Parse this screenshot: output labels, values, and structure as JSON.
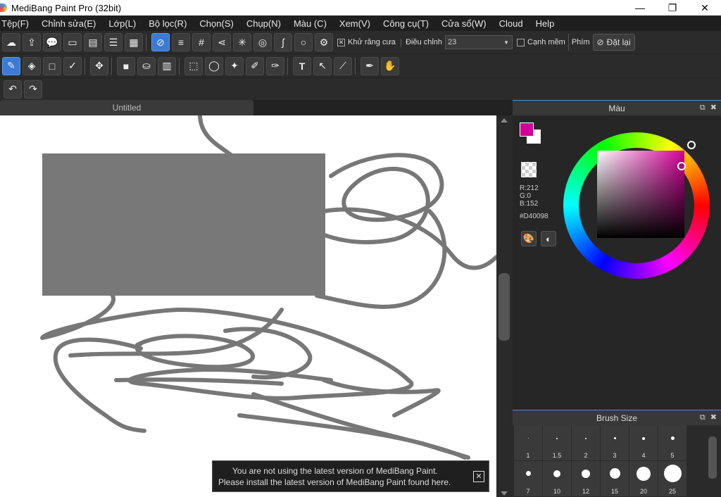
{
  "window": {
    "title": "MediBang Paint Pro (32bit)",
    "minimize_glyph": "—",
    "restore_glyph": "❐",
    "close_glyph": "✕"
  },
  "menu": [
    "Tệp(F)",
    "Chỉnh sửa(E)",
    "Lớp(L)",
    "Bộ lọc(R)",
    "Chọn(S)",
    "Chụp(N)",
    "Màu (C)",
    "Xem(V)",
    "Công cụ(T)",
    "Cửa sổ(W)",
    "Cloud",
    "Help"
  ],
  "toolbar1": {
    "antialias_label": "Khử răng cưa",
    "antialias_checked": true,
    "adjust_label": "Điều chỉnh",
    "adjust_value": "23",
    "soft_edge_label": "Cạnh mềm",
    "soft_edge_checked": false,
    "key_label": "Phím",
    "reset_label": "Đặt lại"
  },
  "document": {
    "tab_title": "Untitled"
  },
  "color_panel": {
    "title": "Màu",
    "r": "R:212",
    "g": "G:0",
    "b": "B:152",
    "hex": "#D40098",
    "main_color": "#D40098"
  },
  "brush_panel": {
    "title": "Brush Size",
    "sizes": [
      "1",
      "1.5",
      "2",
      "3",
      "4",
      "5",
      "7",
      "10",
      "12",
      "15",
      "20",
      "25"
    ]
  },
  "notice": {
    "line1": "You are not using the latest version of MediBang Paint.",
    "line2": "Please install the latest version of MediBang Paint found here."
  }
}
